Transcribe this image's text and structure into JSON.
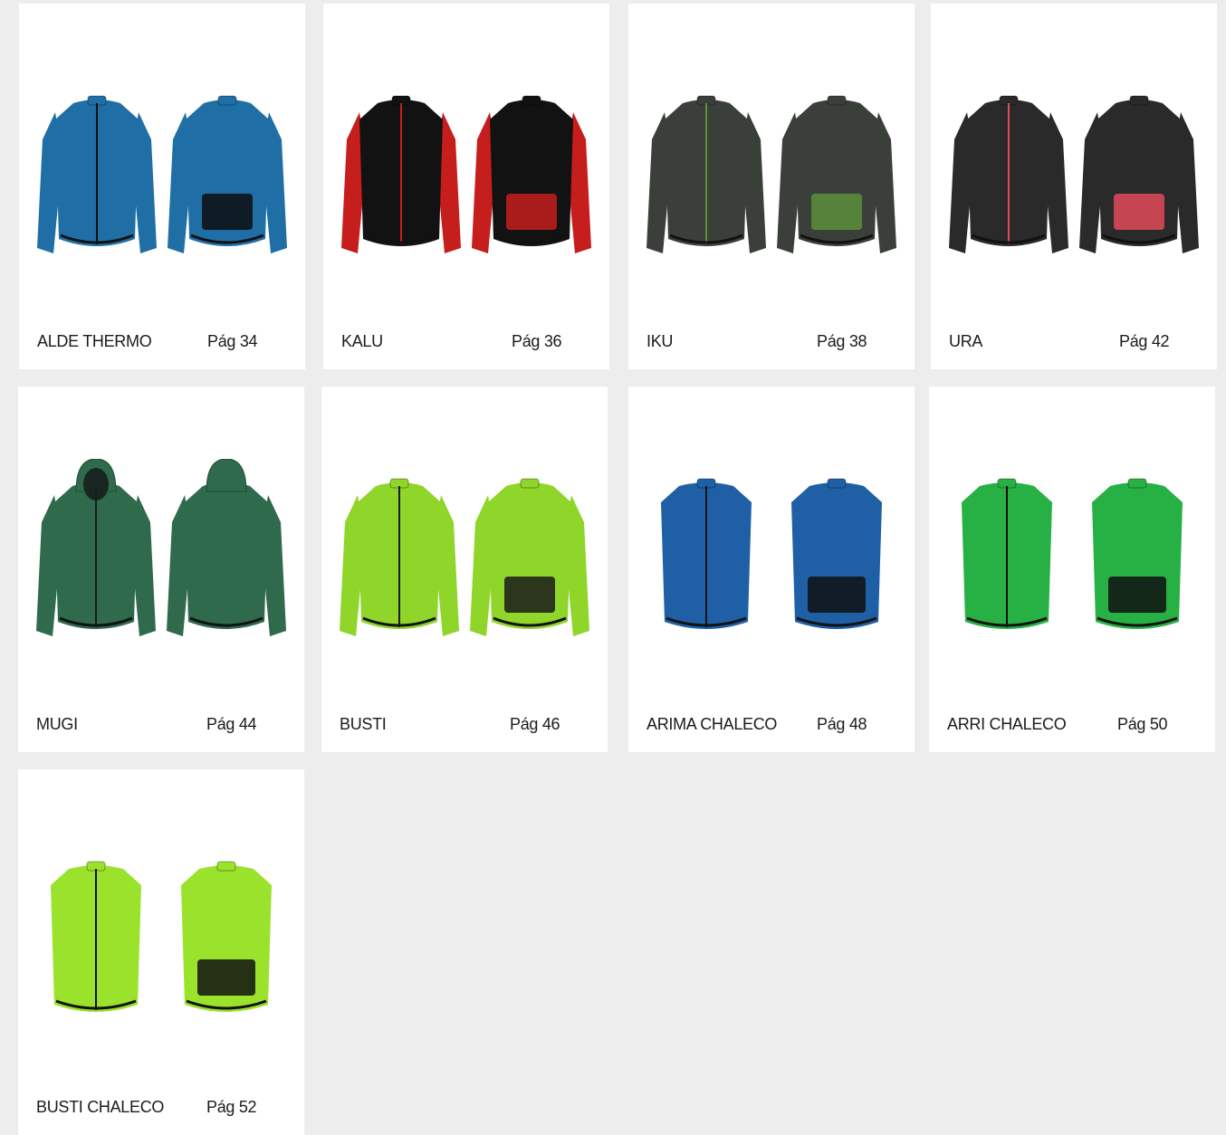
{
  "products": [
    {
      "name": "ALDE THERMO",
      "page": "Pág 34",
      "type": "jersey",
      "body": "#1f6fa6",
      "sleeve": "#1f6fa6",
      "accent": "#0e0e0e"
    },
    {
      "name": "KALU",
      "page": "Pág 36",
      "type": "jersey",
      "body": "#121212",
      "sleeve": "#c61d1d",
      "accent": "#c61d1d"
    },
    {
      "name": "IKU",
      "page": "Pág 38",
      "type": "jersey",
      "body": "#3b3f3a",
      "sleeve": "#3b3f3a",
      "accent": "#5c8f3a"
    },
    {
      "name": "URA",
      "page": "Pág 42",
      "type": "jacket",
      "body": "#2a2a2a",
      "sleeve": "#2a2a2a",
      "accent": "#e04a5a"
    },
    {
      "name": "MUGI",
      "page": "Pág 44",
      "type": "hoodie",
      "body": "#2f6a4d",
      "sleeve": "#2f6a4d",
      "accent": "#1a1a1a"
    },
    {
      "name": "BUSTI",
      "page": "Pág 46",
      "type": "jacket",
      "body": "#8fd52a",
      "sleeve": "#8fd52a",
      "accent": "#1a1a1a"
    },
    {
      "name": "ARIMA CHALECO",
      "page": "Pág 48",
      "type": "vest",
      "body": "#1f5fa6",
      "sleeve": "#1f5fa6",
      "accent": "#111111"
    },
    {
      "name": "ARRI CHALECO",
      "page": "Pág 50",
      "type": "vest",
      "body": "#27b043",
      "sleeve": "#27b043",
      "accent": "#111111"
    },
    {
      "name": "BUSTI CHALECO",
      "page": "Pág 52",
      "type": "vest",
      "body": "#9be22c",
      "sleeve": "#9be22c",
      "accent": "#111111"
    }
  ]
}
